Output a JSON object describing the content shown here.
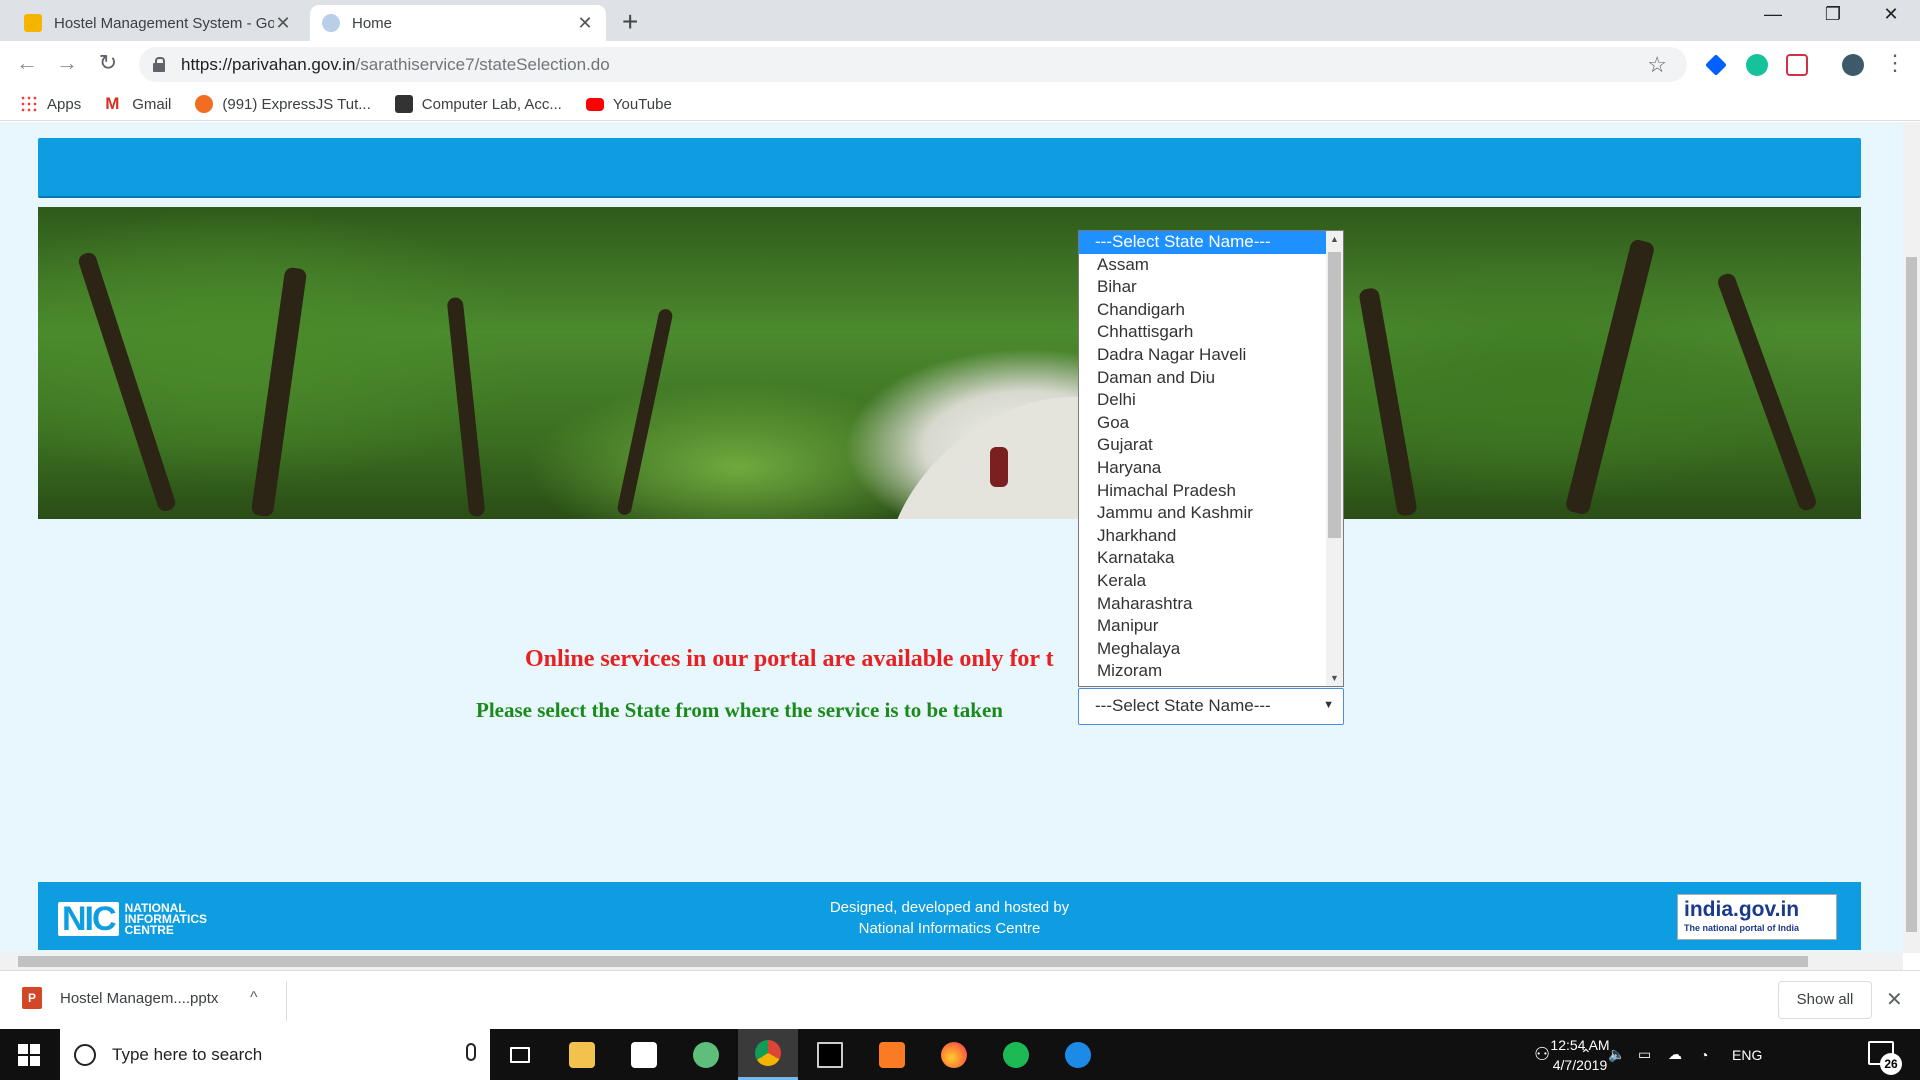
{
  "browser": {
    "tabs": [
      {
        "title": "Hostel Management System - Go",
        "active": false,
        "icon": "slides-icon"
      },
      {
        "title": "Home",
        "active": true,
        "icon": "globe-icon"
      }
    ],
    "url_host": "https://parivahan.gov.in",
    "url_path": "/sarathiservice7/stateSelection.do",
    "bookmarks": [
      {
        "label": "Apps",
        "icon": "apps-grid-icon"
      },
      {
        "label": "Gmail",
        "icon": "gmail-icon"
      },
      {
        "label": "(991) ExpressJS Tut...",
        "icon": "ask-icon"
      },
      {
        "label": "Computer Lab, Acc...",
        "icon": "classroom-icon"
      },
      {
        "label": "YouTube",
        "icon": "youtube-icon"
      }
    ]
  },
  "page": {
    "notice_text": "Online services in our portal are available only for t",
    "prompt_text": "Please select the State from where the service is to be taken",
    "state_select": {
      "selected": "---Select State Name---",
      "options": [
        "---Select State Name---",
        "Assam",
        "Bihar",
        "Chandigarh",
        "Chhattisgarh",
        "Dadra Nagar Haveli",
        "Daman and Diu",
        "Delhi",
        "Goa",
        "Gujarat",
        "Haryana",
        "Himachal Pradesh",
        "Jammu and Kashmir",
        "Jharkhand",
        "Karnataka",
        "Kerala",
        "Maharashtra",
        "Manipur",
        "Meghalaya",
        "Mizoram"
      ]
    },
    "footer": {
      "nic_mark": "NIC",
      "nic_lines": [
        "NATIONAL",
        "INFORMATICS",
        "CENTRE"
      ],
      "designed_by": "Designed, developed and hosted by",
      "org": "National Informatics Centre",
      "india_portal": "india.gov.in",
      "india_tagline": "The national portal of India"
    }
  },
  "downloads": {
    "file": "Hostel Managem....pptx",
    "show_all": "Show all"
  },
  "taskbar": {
    "search_placeholder": "Type here to search",
    "language": "ENG",
    "time": "12:54 AM",
    "date": "4/7/2019",
    "notifications": "26"
  },
  "colors": {
    "header_blue": "#0d9de0",
    "notice_red": "#e82020",
    "prompt_green": "#1a8a1a",
    "selected_option": "#1e90ff"
  }
}
